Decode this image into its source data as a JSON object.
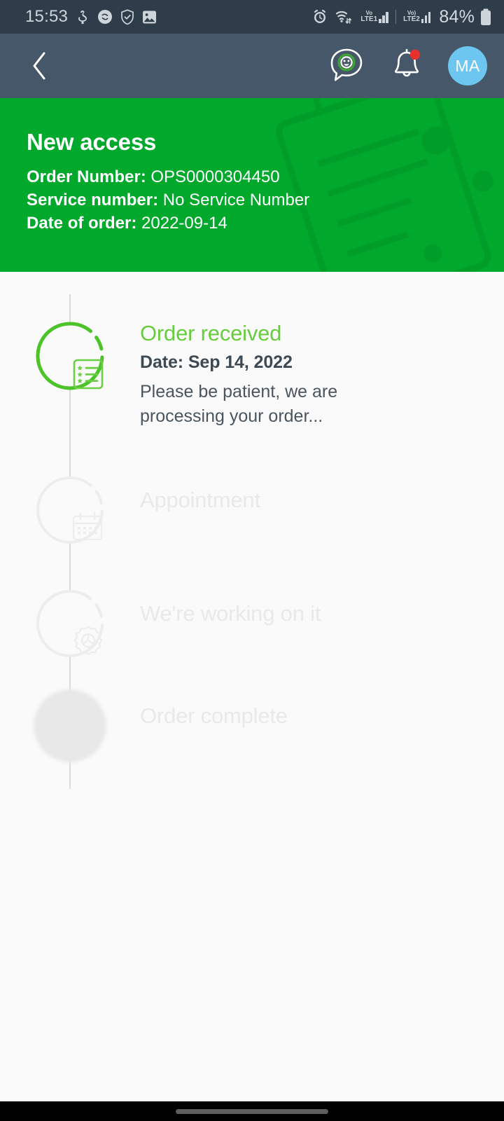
{
  "status_bar": {
    "time": "15:53",
    "battery_percent": "84%",
    "left_icons": [
      "wallet-icon",
      "shazam-icon",
      "shield-check-icon",
      "gallery-icon"
    ],
    "right_icons": [
      "alarm-icon",
      "wifi-icon"
    ],
    "sim1_label_top": "Vo",
    "sim1_label_bottom": "LTE1",
    "sim2_label_top": "Vo)",
    "sim2_label_bottom": "LTE2"
  },
  "app_bar": {
    "back_icon": "chevron-left-icon",
    "chat_icon": "chat-assistant-icon",
    "bell_icon": "notification-bell-icon",
    "bell_badge": true,
    "avatar_initials": "MA",
    "avatar_color": "#6cc6ef",
    "background_color": "#47576a"
  },
  "order_header": {
    "title": "New access",
    "background_color": "#00a82c",
    "fields": [
      {
        "label": "Order Number:",
        "value": "OPS0000304450"
      },
      {
        "label": "Service number:",
        "value": "No Service Number"
      },
      {
        "label": "Date of order:",
        "value": "2022-09-14"
      }
    ]
  },
  "timeline": {
    "active_color": "#68cc3f",
    "inactive_color": "#e9e9e9",
    "steps": [
      {
        "title": "Order received",
        "date": "Date: Sep 14, 2022",
        "description": "Please be patient, we are processing your order...",
        "icon": "checklist-icon",
        "state": "active"
      },
      {
        "title": "Appointment",
        "date": "",
        "description": "",
        "icon": "calendar-icon",
        "state": "inactive"
      },
      {
        "title": "We're working on it",
        "date": "",
        "description": "",
        "icon": "gear-icon",
        "state": "inactive"
      },
      {
        "title": "Order complete",
        "date": "",
        "description": "",
        "icon": "blob-circle-icon",
        "state": "inactive"
      }
    ]
  },
  "nav_bar": {
    "gesture_pill": "home-gesture-pill"
  }
}
